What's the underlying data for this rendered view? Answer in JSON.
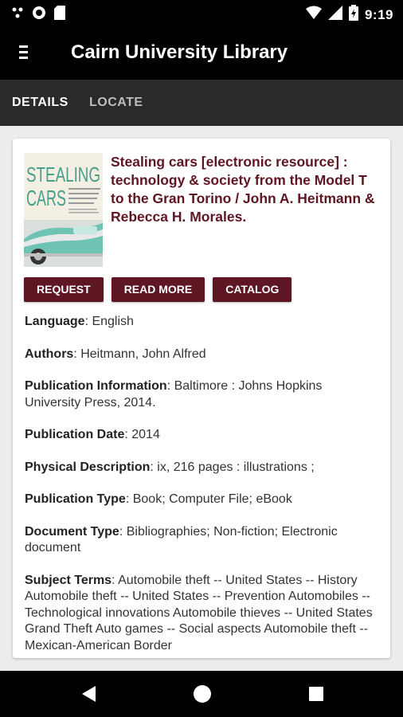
{
  "status_bar": {
    "time": "9:19",
    "left_icons": [
      "notification-icon",
      "sync-icon",
      "sd-card-icon"
    ],
    "right_icons": [
      "wifi-icon",
      "signal-icon",
      "battery-icon"
    ]
  },
  "app_bar": {
    "title": "Cairn University Library"
  },
  "tabs": [
    {
      "label": "DETAILS",
      "active": true
    },
    {
      "label": "LOCATE",
      "active": false
    }
  ],
  "record": {
    "title": "Stealing cars [electronic resource] : technology & society from the Model T to the Gran Torino / John A. Heitmann & Rebecca H. Morales.",
    "cover": {
      "title_line1": "STEALING",
      "title_line2": "CARS",
      "subtitle": "Technology & Society from the Model T to the Gran Torino",
      "authors": "JOHN A. HEITMANN\nREBECCA H. MORALES"
    },
    "buttons": {
      "request": "REQUEST",
      "read_more": "READ MORE",
      "catalog": "CATALOG"
    },
    "fields": [
      {
        "label": "Language",
        "value": "English"
      },
      {
        "label": "Authors",
        "value": "Heitmann, John Alfred"
      },
      {
        "label": "Publication Information",
        "value": "Baltimore : Johns Hopkins University Press, 2014."
      },
      {
        "label": "Publication Date",
        "value": "2014"
      },
      {
        "label": "Physical Description",
        "value": "ix, 216 pages : illustrations ;"
      },
      {
        "label": "Publication Type",
        "value": "Book; Computer File; eBook"
      },
      {
        "label": "Document Type",
        "value": "Bibliographies; Non-fiction; Electronic document"
      },
      {
        "label": "Subject Terms",
        "value": "Automobile theft -- United States -- History Automobile theft -- United States -- Prevention Automobiles -- Technological innovations Automobile thieves -- United States Grand Theft Auto games -- Social aspects Automobile theft -- Mexican-American Border"
      }
    ]
  },
  "colors": {
    "accent": "#5e1622",
    "app_bar": "#000000",
    "tab_bar": "#2a2a2a",
    "background": "#ececec"
  },
  "nav_bar": {
    "icons": [
      "back-icon",
      "home-icon",
      "recents-icon"
    ]
  }
}
